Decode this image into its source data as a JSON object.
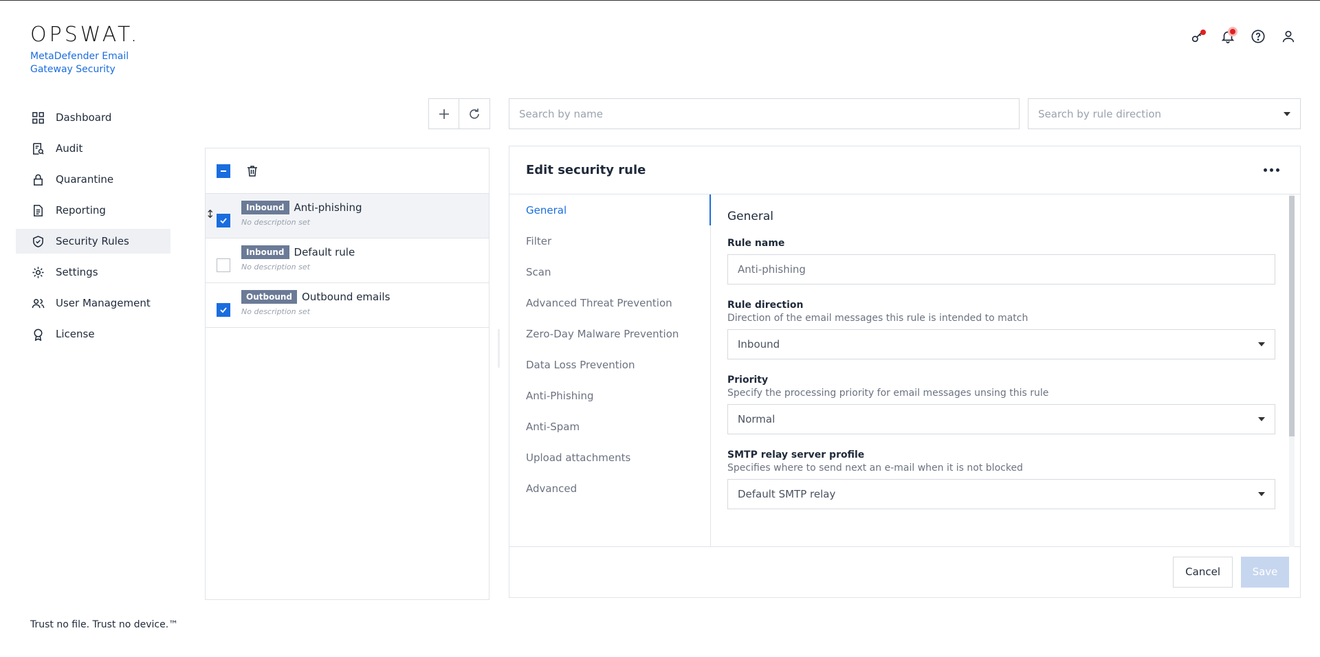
{
  "brand": {
    "logo_text": "OPSWAT.",
    "product": "MetaDefender Email Gateway Security"
  },
  "topbar": {
    "icons": [
      "key-icon",
      "bell-icon",
      "help-icon",
      "user-icon"
    ]
  },
  "sidebar": {
    "items": [
      {
        "label": "Dashboard",
        "icon": "dashboard-icon"
      },
      {
        "label": "Audit",
        "icon": "audit-icon"
      },
      {
        "label": "Quarantine",
        "icon": "lock-icon"
      },
      {
        "label": "Reporting",
        "icon": "document-icon"
      },
      {
        "label": "Security Rules",
        "icon": "shield-check-icon",
        "active": true
      },
      {
        "label": "Settings",
        "icon": "gear-icon"
      },
      {
        "label": "User Management",
        "icon": "users-icon"
      },
      {
        "label": "License",
        "icon": "award-icon"
      }
    ],
    "footer": "Trust no file. Trust no device.™"
  },
  "search": {
    "name_placeholder": "Search by name",
    "direction_placeholder": "Search by rule direction"
  },
  "rules": [
    {
      "direction": "Inbound",
      "name": "Anti-phishing",
      "description": "No description set",
      "checked": true,
      "selected": true
    },
    {
      "direction": "Inbound",
      "name": "Default rule",
      "description": "No description set",
      "checked": false
    },
    {
      "direction": "Outbound",
      "name": "Outbound emails",
      "description": "No description set",
      "checked": true
    }
  ],
  "editor": {
    "title": "Edit security rule",
    "tabs": [
      "General",
      "Filter",
      "Scan",
      "Advanced Threat Prevention",
      "Zero-Day Malware Prevention",
      "Data Loss Prevention",
      "Anti-Phishing",
      "Anti-Spam",
      "Upload attachments",
      "Advanced"
    ],
    "active_tab": "General",
    "section_title": "General",
    "fields": {
      "rule_name": {
        "label": "Rule name",
        "value": "Anti-phishing"
      },
      "rule_direction": {
        "label": "Rule direction",
        "help": "Direction of the email messages this rule is intended to match",
        "value": "Inbound"
      },
      "priority": {
        "label": "Priority",
        "help": "Specify the processing priority for email messages unsing this rule",
        "value": "Normal"
      },
      "smtp_relay": {
        "label": "SMTP relay server profile",
        "help": "Specifies where to send next an e-mail when it is not blocked",
        "value": "Default SMTP relay"
      }
    },
    "cancel_label": "Cancel",
    "save_label": "Save"
  },
  "colors": {
    "accent": "#1a6dde",
    "badge": "#6b7a96",
    "notification": "#e02020"
  }
}
